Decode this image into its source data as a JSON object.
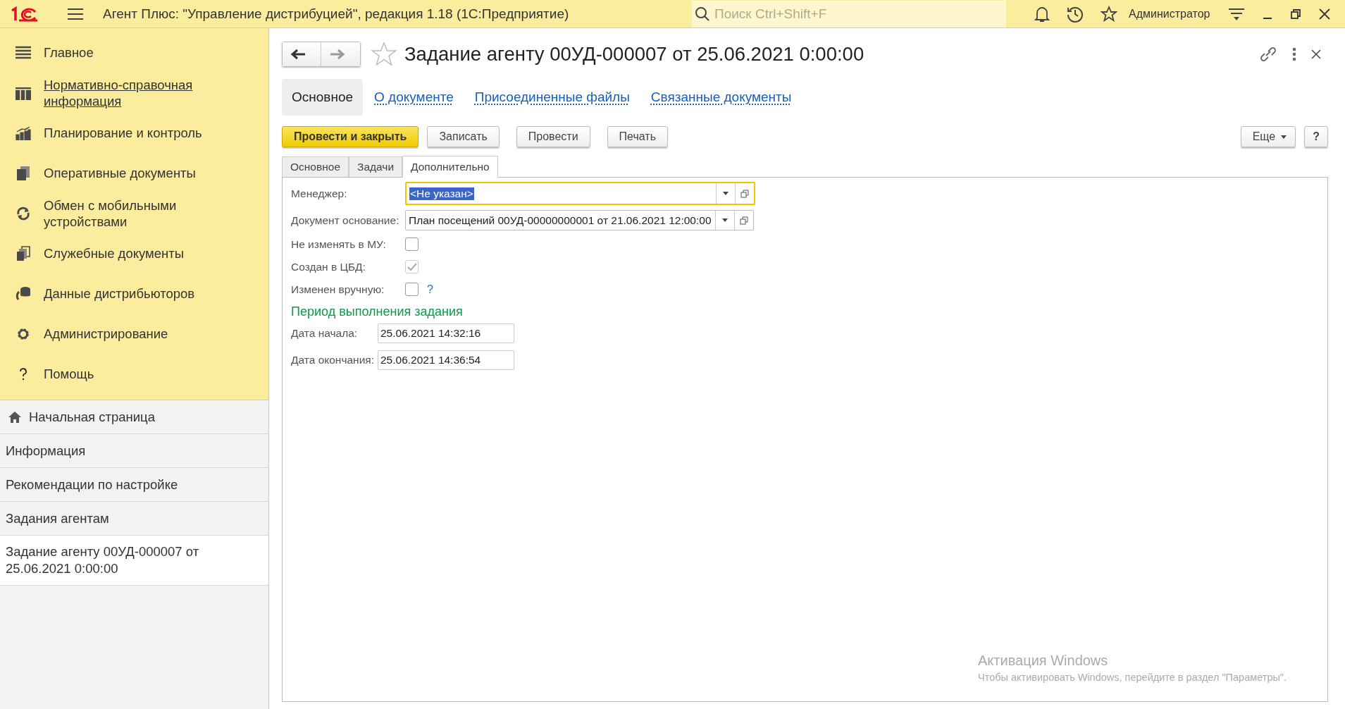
{
  "window": {
    "title": "Агент Плюс: \"Управление дистрибуцией\", редакция 1.18  (1С:Предприятие)",
    "search": {
      "placeholder": "Поиск Ctrl+Shift+F"
    },
    "user": "Администратор"
  },
  "sidebar": {
    "sections": [
      {
        "label": "Главное",
        "hovered": false
      },
      {
        "label": "Нормативно-справочная информация",
        "hovered": true
      },
      {
        "label": "Планирование и контроль",
        "hovered": false
      },
      {
        "label": "Оперативные документы",
        "hovered": false
      },
      {
        "label": "Обмен с мобильными устройствами",
        "hovered": false
      },
      {
        "label": "Служебные документы",
        "hovered": false
      },
      {
        "label": "Данные дистрибьюторов",
        "hovered": false
      },
      {
        "label": "Администрирование",
        "hovered": false
      },
      {
        "label": "Помощь",
        "hovered": false
      }
    ],
    "open_windows": [
      {
        "label": "Начальная страница",
        "kind": "home",
        "selected": false
      },
      {
        "label": "Информация",
        "kind": "plain",
        "selected": false
      },
      {
        "label": "Рекомендации по настройке",
        "kind": "plain",
        "selected": false
      },
      {
        "label": "Задания агентам",
        "kind": "plain",
        "selected": false
      },
      {
        "label": "Задание агенту 00УД-000007 от 25.06.2021 0:00:00",
        "kind": "plain",
        "selected": true
      }
    ]
  },
  "document": {
    "title": "Задание агенту 00УД-000007 от 25.06.2021 0:00:00",
    "favorite": false,
    "tabs": [
      {
        "label": "Основное",
        "selected": true
      },
      {
        "label": "О документе",
        "selected": false
      },
      {
        "label": "Присоединенные файлы",
        "selected": false
      },
      {
        "label": "Связанные документы",
        "selected": false
      }
    ],
    "commands": [
      {
        "label": "Провести и закрыть",
        "kind": "default"
      },
      {
        "label": "Записать",
        "kind": "plain"
      },
      {
        "label": "Провести",
        "kind": "plain"
      },
      {
        "label": "Печать",
        "kind": "plain"
      }
    ],
    "more_button": "Еще",
    "help_button": "?",
    "form_tabs": [
      {
        "label": "Основное",
        "selected": false
      },
      {
        "label": "Задачи",
        "selected": false
      },
      {
        "label": "Дополнительно",
        "selected": true
      }
    ],
    "fields": [
      {
        "label": "Менеджер:",
        "value": "<Не указан>",
        "focused": true
      },
      {
        "label": "Документ основание:",
        "value": "План посещений 00УД-00000000001 от 21.06.2021 12:00:00",
        "focused": false
      }
    ],
    "checkboxes": [
      {
        "label": "Не изменять в МУ:",
        "checked": false,
        "disabled": false
      },
      {
        "label": "Создан в ЦБД:",
        "checked": true,
        "disabled": true
      },
      {
        "label": "Изменен вручную:",
        "checked": false,
        "disabled": false,
        "help": "?"
      }
    ],
    "period": {
      "heading": "Период выполнения задания",
      "dates": [
        {
          "label": "Дата начала:",
          "value": "25.06.2021 14:32:16"
        },
        {
          "label": "Дата окончания:",
          "value": "25.06.2021 14:36:54"
        }
      ]
    }
  },
  "activation": {
    "title": "Активация Windows",
    "text": "Чтобы активировать Windows, перейдите в раздел \"Параметры\"."
  }
}
